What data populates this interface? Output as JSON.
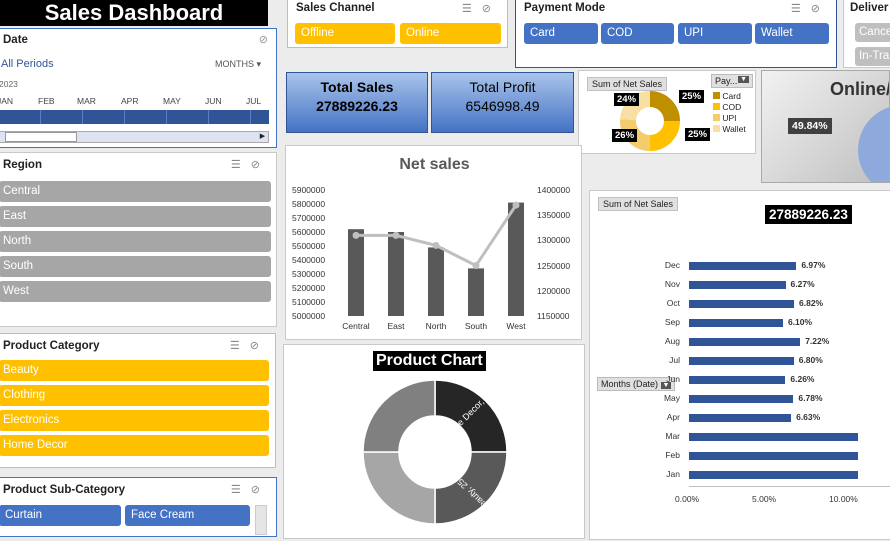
{
  "title": "Sales Dashboard",
  "date_slicer": {
    "header": "Date",
    "selection": "All Periods",
    "granularity": "MONTHS",
    "year": "2023",
    "months": [
      "JAN",
      "FEB",
      "MAR",
      "APR",
      "MAY",
      "JUN",
      "JUL"
    ]
  },
  "region": {
    "header": "Region",
    "items": [
      "Central",
      "East",
      "North",
      "South",
      "West"
    ]
  },
  "product_category": {
    "header": "Product Category",
    "items": [
      "Beauty",
      "Clothing",
      "Electronics",
      "Home Decor"
    ]
  },
  "product_subcategory": {
    "header": "Product Sub-Category",
    "items": [
      "Curtain",
      "Face Cream"
    ]
  },
  "sales_channel": {
    "header": "Sales Channel",
    "items": [
      "Offline",
      "Online"
    ]
  },
  "payment_mode": {
    "header": "Payment Mode",
    "items": [
      "Card",
      "COD",
      "UPI",
      "Wallet"
    ]
  },
  "delivery": {
    "header": "Deliver",
    "items": [
      "Cance",
      "In-Tra"
    ]
  },
  "kpis": {
    "total_sales_label": "Total Sales",
    "total_sales_value": "27889226.23",
    "total_profit_label": "Total Profit",
    "total_profit_value": "6546998.49"
  },
  "payment_chart": {
    "field_label": "Sum of Net Sales",
    "filter_label": "Pay...",
    "legend": [
      "Card",
      "COD",
      "UPI",
      "Wallet"
    ],
    "colors": [
      "#bf8f00",
      "#ffc000",
      "#f4cc6c",
      "#f8dfa3"
    ],
    "labels": [
      "25%",
      "25%",
      "26%",
      "24%"
    ]
  },
  "online_chart": {
    "title": "Online/",
    "label": "49.84%"
  },
  "chart_data": [
    {
      "type": "bar",
      "title": "Net sales",
      "categories": [
        "Central",
        "East",
        "North",
        "South",
        "West"
      ],
      "values": [
        5620000,
        5600000,
        5490000,
        5340000,
        5810000
      ],
      "ylim": [
        5000000,
        5900000
      ],
      "y_ticks": [
        "5900000",
        "5800000",
        "5700000",
        "5600000",
        "5500000",
        "5400000",
        "5300000",
        "5200000",
        "5100000",
        "5000000"
      ],
      "line_values": [
        1310000,
        1310000,
        1290000,
        1250000,
        1370000
      ],
      "y2lim": [
        1150000,
        1400000
      ],
      "y2_ticks": [
        "1400000",
        "1350000",
        "1300000",
        "1250000",
        "1200000",
        "1150000"
      ]
    },
    {
      "type": "pie",
      "title": "Product Chart",
      "categories": [
        "Home Decor",
        "Beauty",
        "Electronics",
        "Clothing"
      ],
      "values": [
        25,
        25,
        25,
        25
      ],
      "labels": [
        "Home Decor, 25%",
        "Beauty, 25%",
        "",
        ""
      ],
      "colors": [
        "#262626",
        "#595959",
        "#a6a6a6",
        "#808080"
      ]
    },
    {
      "type": "bar",
      "orientation": "horizontal",
      "field_label": "Sum of Net Sales",
      "total": "27889226.23",
      "axis_field": "Months (Date)",
      "categories": [
        "Dec",
        "Nov",
        "Oct",
        "Sep",
        "Aug",
        "Jul",
        "Jun",
        "May",
        "Apr",
        "Mar",
        "Feb",
        "Jan"
      ],
      "values": [
        6.97,
        6.27,
        6.82,
        6.1,
        7.22,
        6.8,
        6.26,
        6.78,
        6.63,
        11.0,
        11.0,
        11.0
      ],
      "labels": [
        "6.97%",
        "6.27%",
        "6.82%",
        "6.10%",
        "7.22%",
        "6.80%",
        "6.26%",
        "6.78%",
        "6.63%",
        "",
        "",
        ""
      ],
      "x_ticks": [
        "0.00%",
        "5.00%",
        "10.00%"
      ],
      "xlim": [
        0,
        10
      ]
    }
  ]
}
